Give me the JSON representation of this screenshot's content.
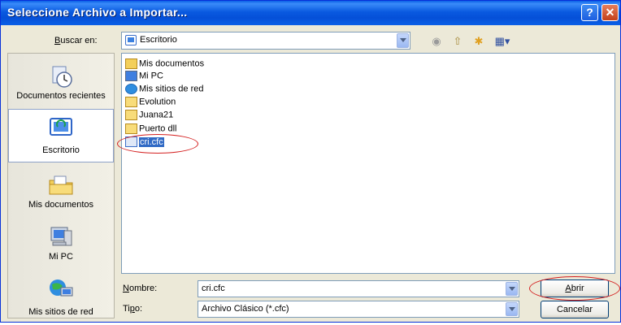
{
  "window": {
    "title": "Seleccione Archivo a Importar..."
  },
  "lookin": {
    "label": "Buscar en:",
    "value": "Escritorio"
  },
  "toolbar": [
    {
      "icon": "back-icon"
    },
    {
      "icon": "up-folder-icon"
    },
    {
      "icon": "new-folder-icon"
    },
    {
      "icon": "view-menu-icon"
    }
  ],
  "places": [
    {
      "label": "Documentos recientes",
      "icon": "recent-documents-icon"
    },
    {
      "label": "Escritorio",
      "icon": "desktop-icon"
    },
    {
      "label": "Mis documentos",
      "icon": "my-documents-icon"
    },
    {
      "label": "Mi PC",
      "icon": "my-computer-icon"
    },
    {
      "label": "Mis sitios de red",
      "icon": "network-places-icon"
    }
  ],
  "files": [
    {
      "name": "Mis documentos",
      "icon": "my-documents-icon"
    },
    {
      "name": "Mi PC",
      "icon": "my-computer-icon"
    },
    {
      "name": "Mis sitios de red",
      "icon": "network-places-icon"
    },
    {
      "name": "Evolution",
      "icon": "folder-icon"
    },
    {
      "name": "Juana21",
      "icon": "folder-icon"
    },
    {
      "name": "Puerto dll",
      "icon": "folder-icon"
    },
    {
      "name": "cri.cfc",
      "icon": "file-icon",
      "selected": true
    }
  ],
  "filename": {
    "label": "Nombre:",
    "value": "cri.cfc"
  },
  "filetype": {
    "label": "Tipo:",
    "value": "Archivo Clásico (*.cfc)"
  },
  "buttons": {
    "open": "Abrir",
    "cancel": "Cancelar"
  },
  "colors": {
    "titlebar": "#0a5ae0",
    "selection": "#316ac5",
    "annotation": "#d42020",
    "dialog": "#ece9d8"
  }
}
